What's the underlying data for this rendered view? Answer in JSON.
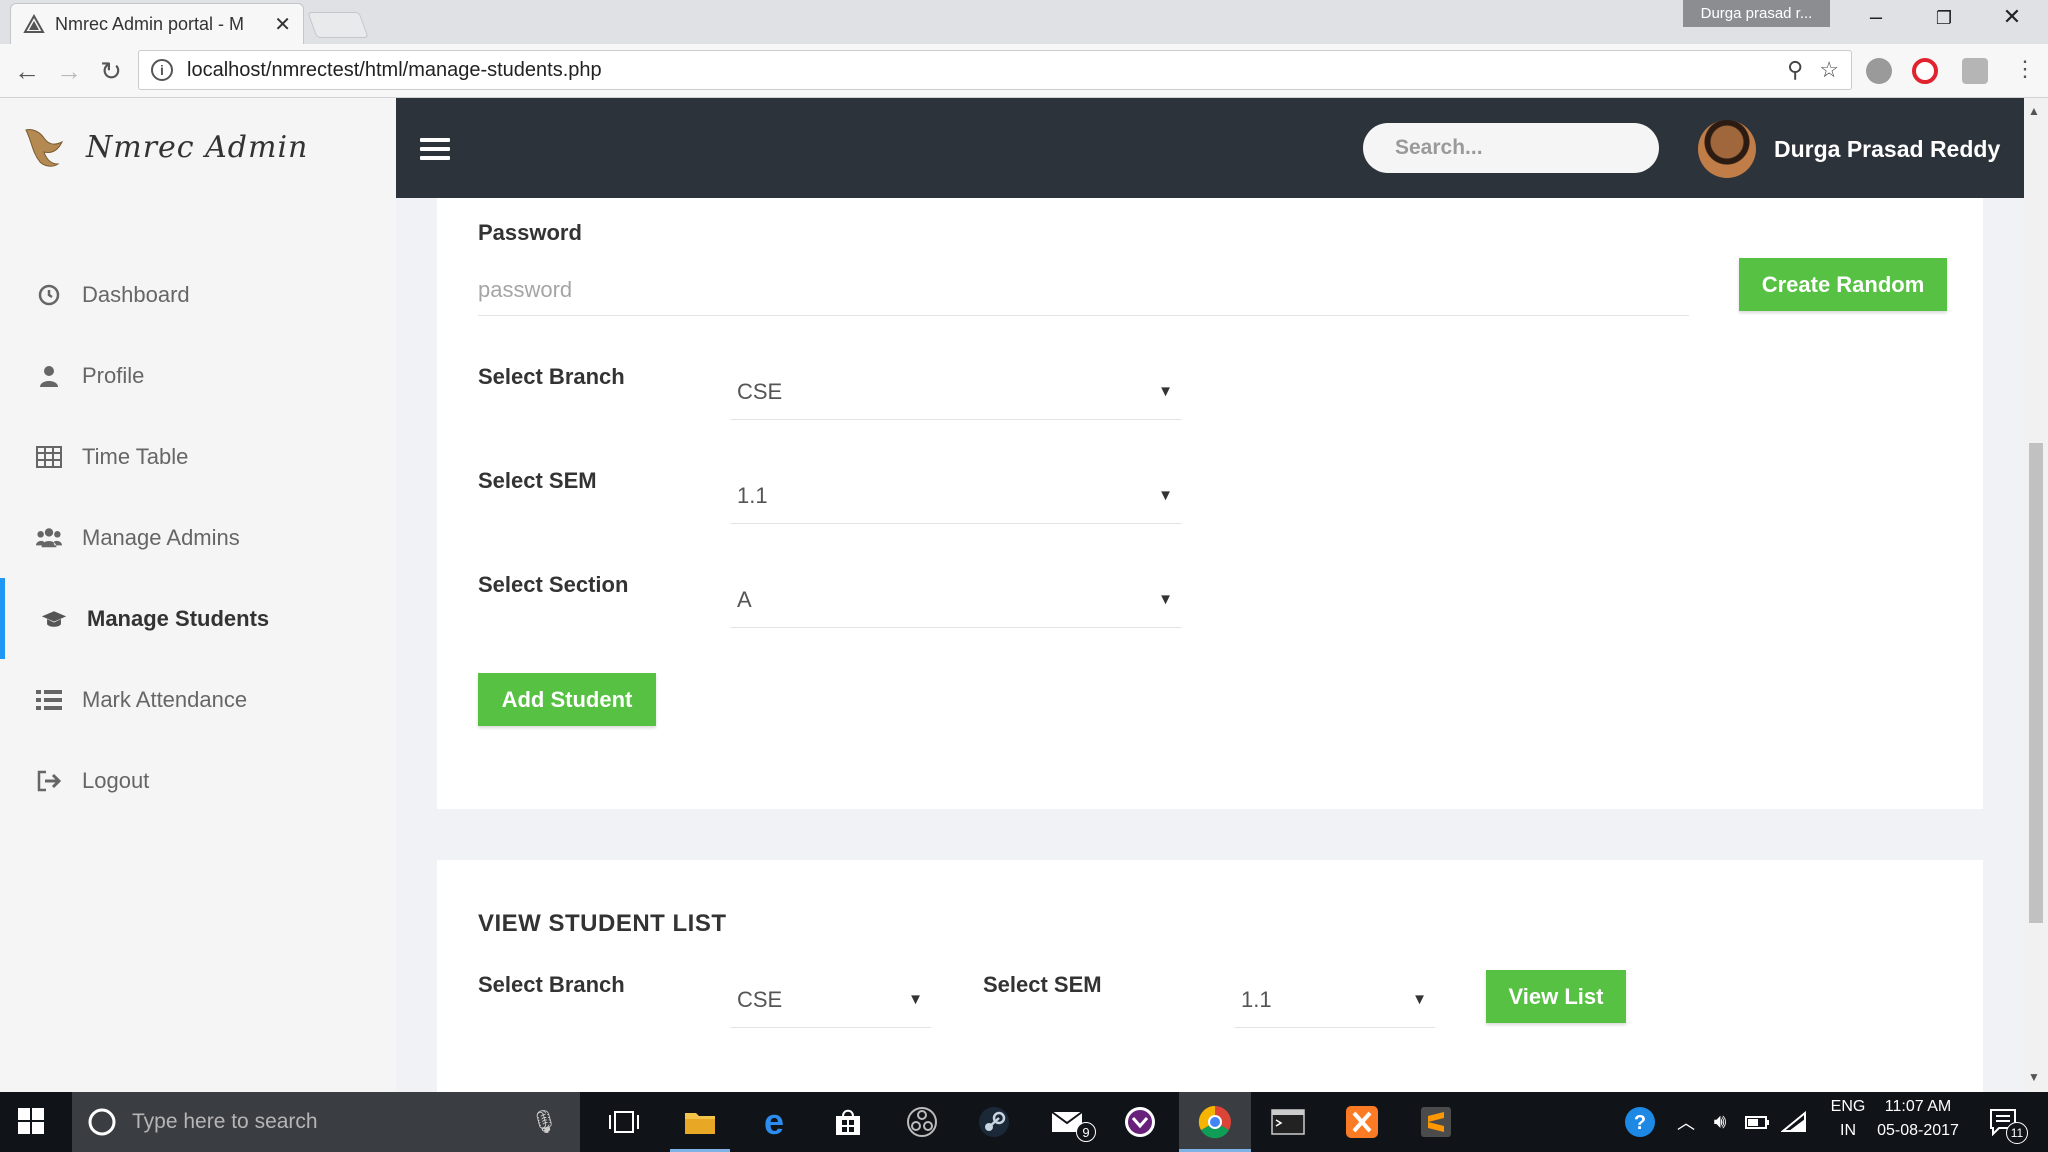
{
  "browser": {
    "tab_title": "Nmrec Admin portal - M",
    "profile_name": "Durga prasad r...",
    "url": "localhost/nmrectest/html/manage-students.php"
  },
  "sidebar": {
    "brand": "Nmrec Admin",
    "items": [
      {
        "label": "Dashboard",
        "icon": "clock-icon"
      },
      {
        "label": "Profile",
        "icon": "user-icon"
      },
      {
        "label": "Time Table",
        "icon": "table-icon"
      },
      {
        "label": "Manage Admins",
        "icon": "users-icon"
      },
      {
        "label": "Manage Students",
        "icon": "graduation-cap-icon",
        "active": true
      },
      {
        "label": "Mark Attendance",
        "icon": "list-icon"
      },
      {
        "label": "Logout",
        "icon": "sign-out-icon"
      }
    ]
  },
  "topbar": {
    "search_placeholder": "Search...",
    "user_name": "Durga Prasad Reddy"
  },
  "add_form": {
    "password_label": "Password",
    "password_placeholder": "password",
    "create_random_label": "Create Random",
    "branch_label": "Select Branch",
    "branch_value": "CSE",
    "sem_label": "Select SEM",
    "sem_value": "1.1",
    "section_label": "Select Section",
    "section_value": "A",
    "add_button": "Add Student"
  },
  "view_list": {
    "title": "VIEW STUDENT LIST",
    "branch_label": "Select Branch",
    "branch_value": "CSE",
    "sem_label": "Select SEM",
    "sem_value": "1.1",
    "view_button": "View List"
  },
  "taskbar": {
    "search_placeholder": "Type here to search",
    "mail_badge": "9",
    "language": "ENG",
    "region": "IN",
    "time": "11:07 AM",
    "date": "05-08-2017",
    "notification_count": "11"
  },
  "colors": {
    "accent_green": "#56c142",
    "topbar_dark": "#2d333b",
    "active_indicator": "#2196f3"
  }
}
